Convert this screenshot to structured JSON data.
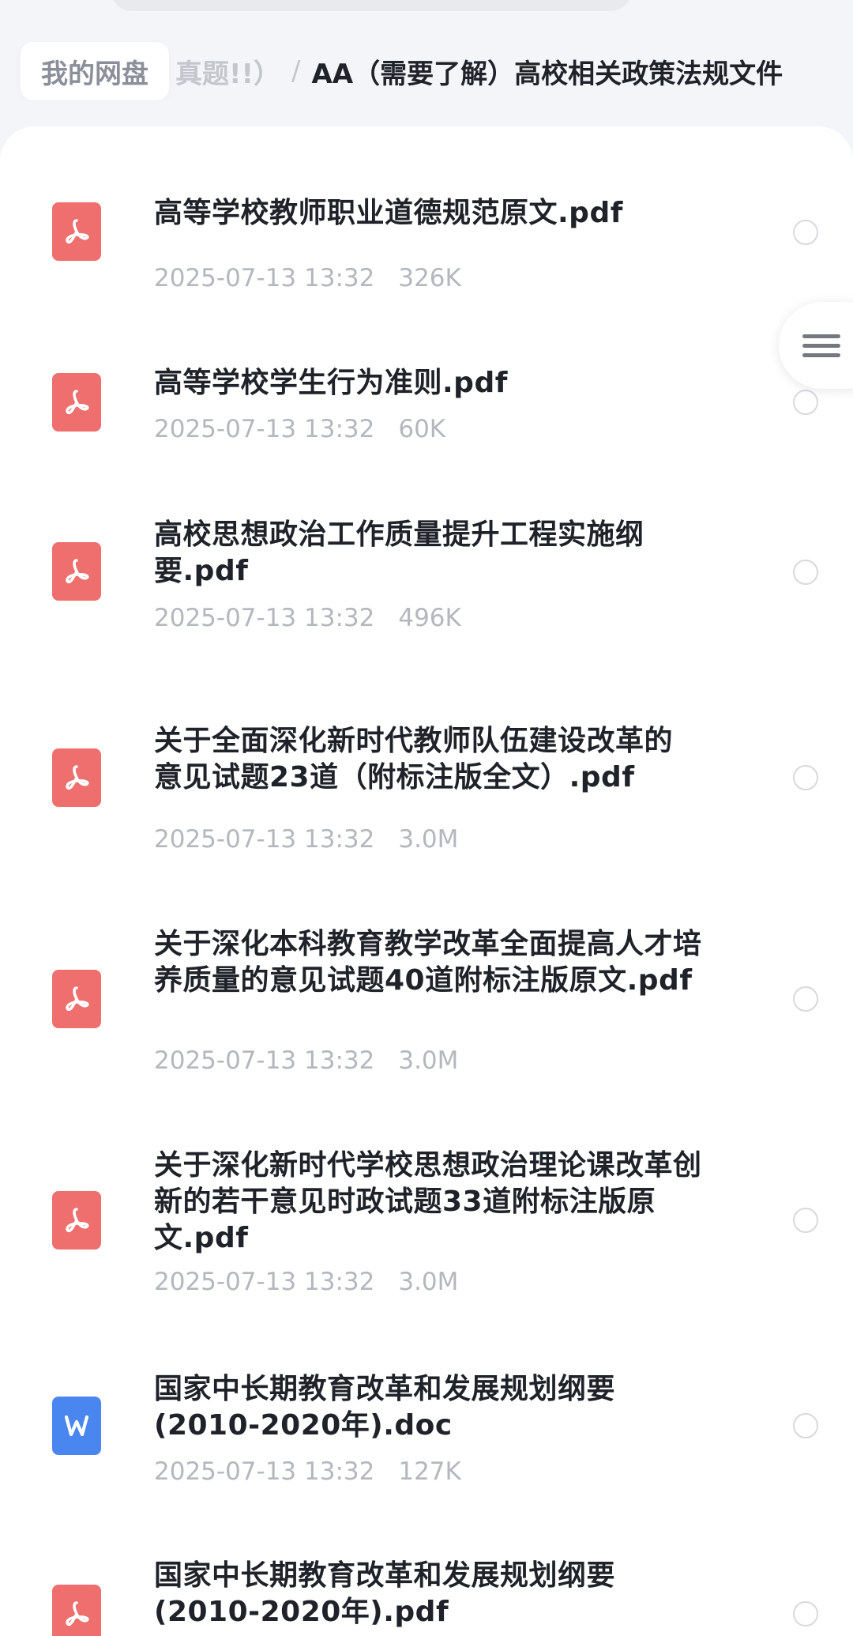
{
  "breadcrumb": {
    "root": "我的网盘",
    "middle": "真题!!）",
    "separator": "/",
    "current": "AA（需要了解）高校相关政策法规文件"
  },
  "files": [
    {
      "name": "高等学校教师职业道德规范原文.pdf",
      "date": "2025-07-13 13:32",
      "size": "326K",
      "type": "pdf"
    },
    {
      "name": "高等学校学生行为准则.pdf",
      "date": "2025-07-13 13:32",
      "size": "60K",
      "type": "pdf"
    },
    {
      "name": "高校思想政治工作质量提升工程实施纲要.pdf",
      "date": "2025-07-13 13:32",
      "size": "496K",
      "type": "pdf"
    },
    {
      "name": "关于全面深化新时代教师队伍建设改革的意见试题23道（附标注版全文）.pdf",
      "date": "2025-07-13 13:32",
      "size": "3.0M",
      "type": "pdf"
    },
    {
      "name": "关于深化本科教育教学改革全面提高人才培养质量的意见试题40道附标注版原文.pdf",
      "date": "2025-07-13 13:32",
      "size": "3.0M",
      "type": "pdf"
    },
    {
      "name": "关于深化新时代学校思想政治理论课改革创新的若干意见时政试题33道附标注版原文.pdf",
      "date": "2025-07-13 13:32",
      "size": "3.0M",
      "type": "pdf"
    },
    {
      "name": "国家中长期教育改革和发展规划纲要(2010-2020年).doc",
      "date": "2025-07-13 13:32",
      "size": "127K",
      "type": "doc"
    },
    {
      "name": "国家中长期教育改革和发展规划纲要(2010-2020年).pdf",
      "date": "",
      "size": "",
      "type": "pdf"
    }
  ],
  "icons": {
    "pdf": "pdf-file-icon",
    "doc": "word-file-icon",
    "menu": "menu-icon"
  },
  "colors": {
    "pdf": "#ef6e6e",
    "doc": "#4a86f0",
    "meta": "#b4b7bd"
  }
}
